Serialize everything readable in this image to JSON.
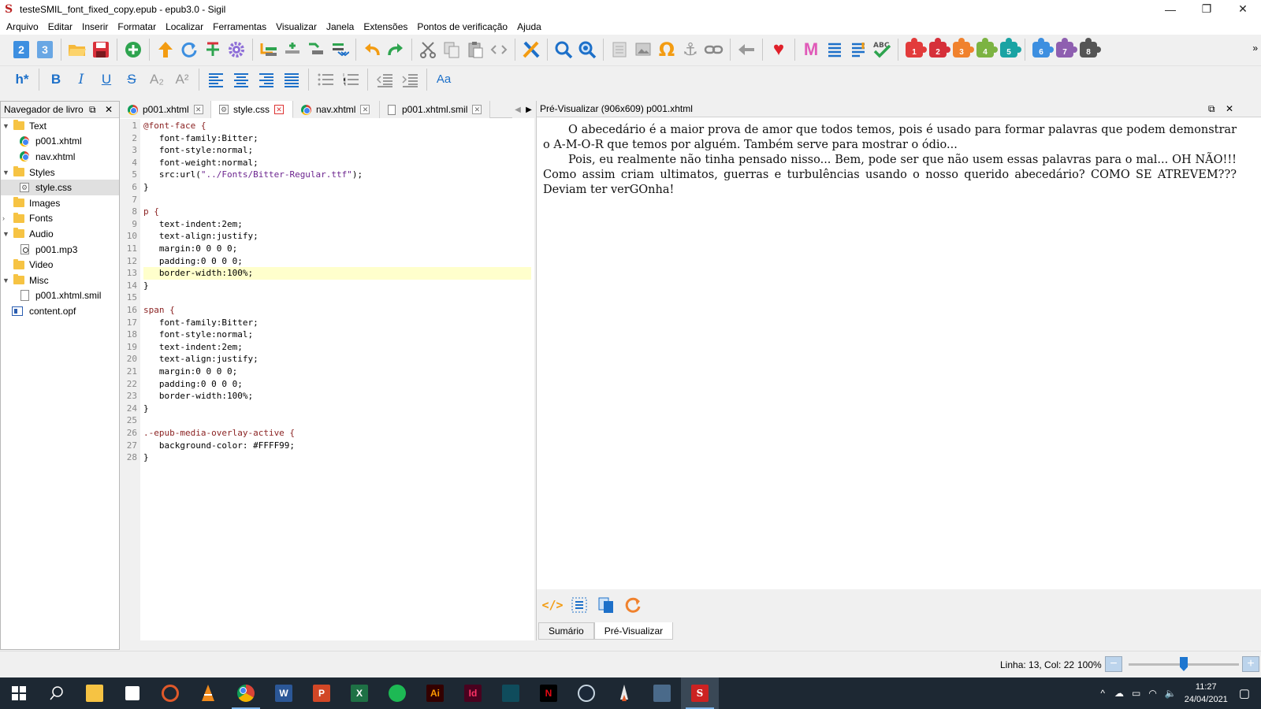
{
  "window": {
    "title": "testeSMIL_font_fixed_copy.epub - epub3.0 - Sigil",
    "minimize": "—",
    "restore": "❐",
    "close": "✕"
  },
  "menu": [
    "Arquivo",
    "Editar",
    "Inserir",
    "Formatar",
    "Localizar",
    "Ferramentas",
    "Visualizar",
    "Janela",
    "Extensões",
    "Pontos de verificação",
    "Ajuda"
  ],
  "toolbar": {
    "version2": "2",
    "version3": "3",
    "heading": "h*",
    "bold": "B",
    "italic": "I",
    "underline": "U",
    "strike": "S",
    "subscript": "A₂",
    "superscript": "A²",
    "case": "Aa",
    "plugins": [
      "1",
      "2",
      "3",
      "4",
      "5",
      "6",
      "7",
      "8"
    ],
    "overflow": "»"
  },
  "book_browser": {
    "title": "Navegador de livro",
    "items": [
      {
        "label": "Text",
        "type": "folder",
        "expanded": true
      },
      {
        "label": "p001.xhtml",
        "type": "xhtml"
      },
      {
        "label": "nav.xhtml",
        "type": "xhtml"
      },
      {
        "label": "Styles",
        "type": "folder",
        "expanded": true
      },
      {
        "label": "style.css",
        "type": "css",
        "selected": true
      },
      {
        "label": "Images",
        "type": "folder"
      },
      {
        "label": "Fonts",
        "type": "folder"
      },
      {
        "label": "Audio",
        "type": "folder",
        "expanded": true
      },
      {
        "label": "p001.mp3",
        "type": "audio"
      },
      {
        "label": "Video",
        "type": "folder"
      },
      {
        "label": "Misc",
        "type": "folder",
        "expanded": true
      },
      {
        "label": "p001.xhtml.smil",
        "type": "file"
      },
      {
        "label": "content.opf",
        "type": "opf"
      }
    ]
  },
  "tabs": [
    {
      "label": "p001.xhtml",
      "icon": "chrome"
    },
    {
      "label": "style.css",
      "icon": "css",
      "active": true
    },
    {
      "label": "nav.xhtml",
      "icon": "chrome"
    },
    {
      "label": "p001.xhtml.smil",
      "icon": "file"
    }
  ],
  "code_lines": [
    "@font-face {",
    "   font-family:Bitter;",
    "   font-style:normal;",
    "   font-weight:normal;",
    "   src:url(\"../Fonts/Bitter-Regular.ttf\");",
    "}",
    "",
    "p {",
    "   text-indent:2em;",
    "   text-align:justify;",
    "   margin:0 0 0 0;",
    "   padding:0 0 0 0;",
    "   border-width:100%;",
    "}",
    "",
    "span {",
    "   font-family:Bitter;",
    "   font-style:normal;",
    "   text-indent:2em;",
    "   text-align:justify;",
    "   margin:0 0 0 0;",
    "   padding:0 0 0 0;",
    "   border-width:100%;",
    "}",
    "",
    ".-epub-media-overlay-active {",
    "   background-color: #FFFF99;",
    "}"
  ],
  "highlighted_line": 13,
  "preview": {
    "title": "Pré-Visualizar (906x609) p001.xhtml",
    "paragraphs": [
      "O abecedário é a maior prova de amor que todos temos, pois é usado para formar palavras que podem demonstrar o A-M-O-R que temos por alguém. Também serve para mostrar o ódio...",
      "Pois, eu realmente não tinha pensado nisso... Bem, pode ser que não usem essas palavras para o mal... OH NÃO!!! Como assim criam ultimatos, guerras e turbulências usando o nosso querido abecedário? COMO SE ATREVEM??? Deviam ter verGOnha!"
    ],
    "bottom_tabs": [
      "Sumário",
      "Pré-Visualizar"
    ]
  },
  "status": {
    "position": "Linha: 13, Col: 22",
    "zoom": "100%",
    "zoom_level": 0.5
  },
  "taskbar": {
    "time": "11:27",
    "date": "24/04/2021"
  },
  "colors": {
    "highlight": "#ffffcc",
    "selector": "#8b2323",
    "string": "#6b238e",
    "accent": "#1e77d0"
  }
}
